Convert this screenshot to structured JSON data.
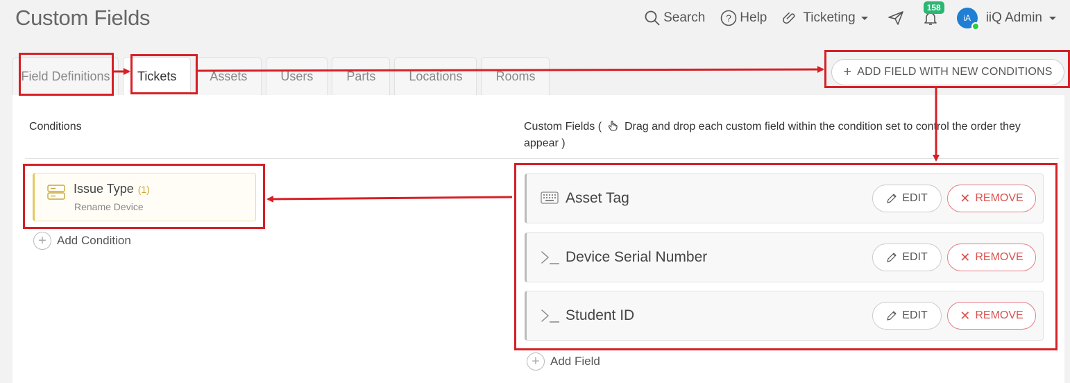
{
  "page": {
    "title": "Custom Fields"
  },
  "topnav": {
    "search": "Search",
    "help": "Help",
    "module": "Ticketing",
    "notifications_count": "158",
    "avatar_initials": "iA",
    "user_name": "iiQ Admin"
  },
  "tabs": [
    "Field Definitions",
    "Tickets",
    "Assets",
    "Users",
    "Parts",
    "Locations",
    "Rooms"
  ],
  "active_tab": "Tickets",
  "add_field_button": "ADD FIELD WITH NEW CONDITIONS",
  "conditions": {
    "title": "Conditions",
    "items": [
      {
        "name": "Issue Type",
        "count": "(1)",
        "value": "Rename Device"
      }
    ],
    "add_label": "Add Condition"
  },
  "custom_fields": {
    "title_prefix": "Custom Fields (",
    "title_hint": "Drag and drop each custom field within the condition set to control the order they appear )",
    "items": [
      {
        "name": "Asset Tag",
        "icon": "keyboard-icon"
      },
      {
        "name": "Device Serial Number",
        "icon": "terminal-icon"
      },
      {
        "name": "Student ID",
        "icon": "terminal-icon"
      }
    ],
    "edit_label": "EDIT",
    "remove_label": "REMOVE",
    "add_label": "Add Field"
  },
  "colors": {
    "annotation": "#d62026",
    "notification_badge": "#2bb673",
    "remove": "#d9534f",
    "condition_accent": "#e4c95f",
    "avatar": "#1e7fd4"
  }
}
